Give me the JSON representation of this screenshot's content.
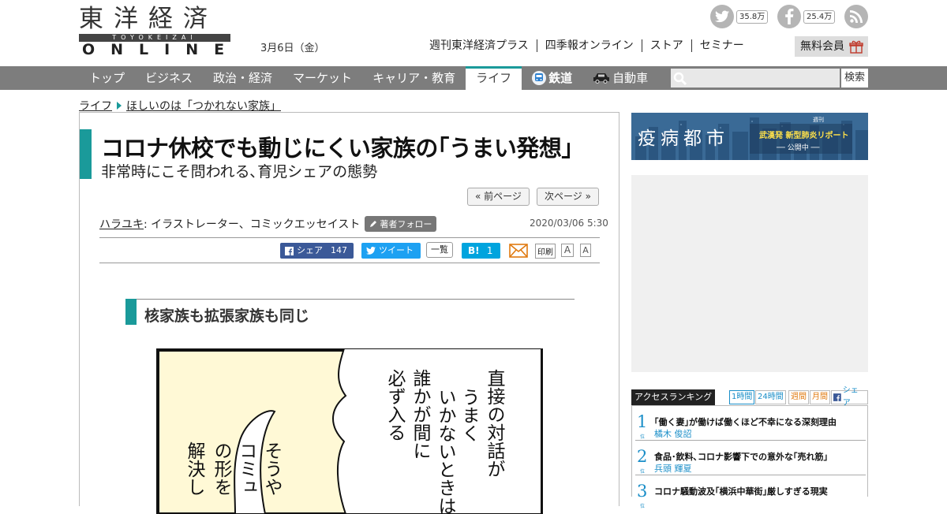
{
  "header": {
    "logo_kanji": "東洋経済",
    "logo_romaji": "TOYOKEIZAI",
    "logo_online": "ONLINE",
    "date": "3月6日（金）",
    "social": {
      "twitter_count": "35.8万",
      "facebook_count": "25.4万"
    },
    "links": [
      "週刊東洋経済プラス",
      "四季報オンライン",
      "ストア",
      "セミナー"
    ],
    "member_button": "無料会員"
  },
  "nav": {
    "items": [
      "トップ",
      "ビジネス",
      "政治・経済",
      "マーケット",
      "キャリア・教育",
      "ライフ"
    ],
    "active": "ライフ",
    "rail": "鉄道",
    "car": "自動車",
    "search_button": "検索",
    "accent_color": "#1a9a9a"
  },
  "breadcrumb": {
    "section": "ライフ",
    "series": "ほしいのは「つかれない家族」"
  },
  "article": {
    "title": "コロナ休校でも動じにくい家族の｢うまい発想｣",
    "subtitle": "非常時にこそ問われる､育児シェアの態勢",
    "prev_label": "« 前ページ",
    "next_label": "次ページ »",
    "author_name": "ハラユキ",
    "author_role": " : イラストレーター、コミックエッセイスト",
    "follow_label": "著者フォロー",
    "date": "2020/03/06 5:30",
    "share": {
      "facebook_label": "シェア",
      "facebook_count": "147",
      "tweet_label": "ツイート",
      "list_label": "一覧",
      "hatena_label": "B!",
      "hatena_count": "1",
      "print_label": "印刷",
      "font_large": "A",
      "font_small": "A"
    },
    "section_heading": "核家族も拡張家族も同じ",
    "comic_text_right": [
      "直接の対話が",
      "うまく",
      "いかないときは",
      "誰かが間に",
      "必ず入る"
    ],
    "comic_text_left": [
      "そうや",
      "コミュ",
      "の形を",
      "解決し"
    ]
  },
  "sidebar": {
    "ad": {
      "title": "疫病都市",
      "small": "週刊",
      "sub": "武漢発 新型肺炎リポート",
      "sub2": "── 公開中 ──"
    },
    "ranking": {
      "title": "アクセスランキング",
      "tabs": [
        "1時間",
        "24時間",
        "週間",
        "月間",
        "シェア"
      ],
      "items": [
        {
          "rank": "1",
          "suffix": "位",
          "title": "｢働く妻｣が働けば働くほど不幸になる深刻理由",
          "author": "橘木 俊詔"
        },
        {
          "rank": "2",
          "suffix": "位",
          "title": "食品･飲料､コロナ影響下での意外な｢売れ筋｣",
          "author": "兵頭 輝夏"
        },
        {
          "rank": "3",
          "suffix": "位",
          "title": "コロナ騒動波及｢横浜中華街｣厳しすぎる現実",
          "author": ""
        }
      ]
    }
  }
}
